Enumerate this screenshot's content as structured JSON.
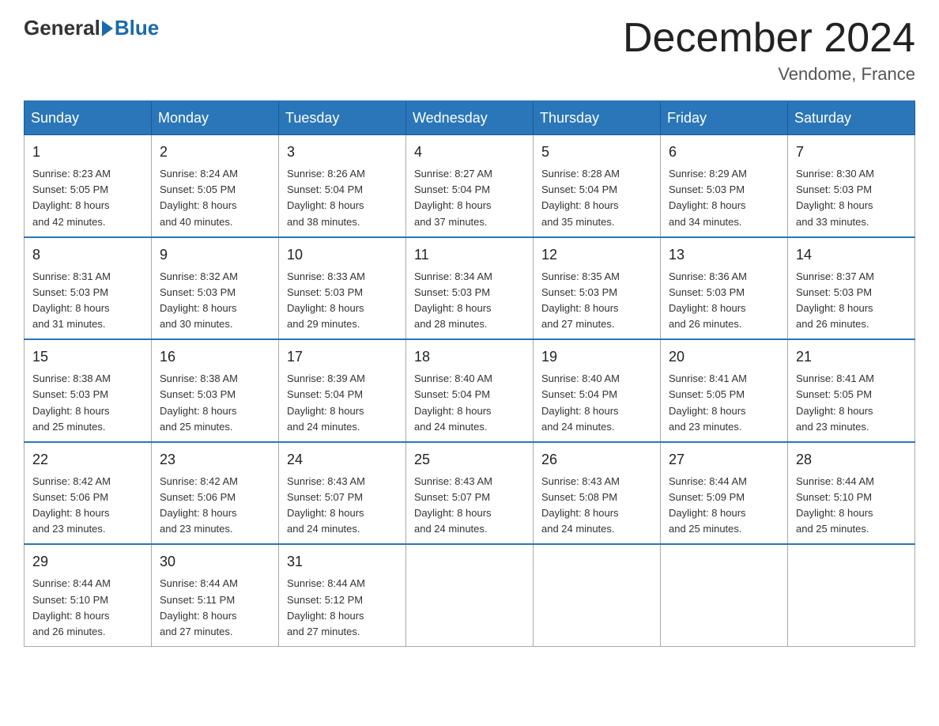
{
  "header": {
    "logo_general": "General",
    "logo_blue": "Blue",
    "month_title": "December 2024",
    "location": "Vendome, France"
  },
  "days_of_week": [
    "Sunday",
    "Monday",
    "Tuesday",
    "Wednesday",
    "Thursday",
    "Friday",
    "Saturday"
  ],
  "weeks": [
    [
      {
        "date": "1",
        "sunrise": "Sunrise: 8:23 AM",
        "sunset": "Sunset: 5:05 PM",
        "daylight": "Daylight: 8 hours",
        "daylight2": "and 42 minutes."
      },
      {
        "date": "2",
        "sunrise": "Sunrise: 8:24 AM",
        "sunset": "Sunset: 5:05 PM",
        "daylight": "Daylight: 8 hours",
        "daylight2": "and 40 minutes."
      },
      {
        "date": "3",
        "sunrise": "Sunrise: 8:26 AM",
        "sunset": "Sunset: 5:04 PM",
        "daylight": "Daylight: 8 hours",
        "daylight2": "and 38 minutes."
      },
      {
        "date": "4",
        "sunrise": "Sunrise: 8:27 AM",
        "sunset": "Sunset: 5:04 PM",
        "daylight": "Daylight: 8 hours",
        "daylight2": "and 37 minutes."
      },
      {
        "date": "5",
        "sunrise": "Sunrise: 8:28 AM",
        "sunset": "Sunset: 5:04 PM",
        "daylight": "Daylight: 8 hours",
        "daylight2": "and 35 minutes."
      },
      {
        "date": "6",
        "sunrise": "Sunrise: 8:29 AM",
        "sunset": "Sunset: 5:03 PM",
        "daylight": "Daylight: 8 hours",
        "daylight2": "and 34 minutes."
      },
      {
        "date": "7",
        "sunrise": "Sunrise: 8:30 AM",
        "sunset": "Sunset: 5:03 PM",
        "daylight": "Daylight: 8 hours",
        "daylight2": "and 33 minutes."
      }
    ],
    [
      {
        "date": "8",
        "sunrise": "Sunrise: 8:31 AM",
        "sunset": "Sunset: 5:03 PM",
        "daylight": "Daylight: 8 hours",
        "daylight2": "and 31 minutes."
      },
      {
        "date": "9",
        "sunrise": "Sunrise: 8:32 AM",
        "sunset": "Sunset: 5:03 PM",
        "daylight": "Daylight: 8 hours",
        "daylight2": "and 30 minutes."
      },
      {
        "date": "10",
        "sunrise": "Sunrise: 8:33 AM",
        "sunset": "Sunset: 5:03 PM",
        "daylight": "Daylight: 8 hours",
        "daylight2": "and 29 minutes."
      },
      {
        "date": "11",
        "sunrise": "Sunrise: 8:34 AM",
        "sunset": "Sunset: 5:03 PM",
        "daylight": "Daylight: 8 hours",
        "daylight2": "and 28 minutes."
      },
      {
        "date": "12",
        "sunrise": "Sunrise: 8:35 AM",
        "sunset": "Sunset: 5:03 PM",
        "daylight": "Daylight: 8 hours",
        "daylight2": "and 27 minutes."
      },
      {
        "date": "13",
        "sunrise": "Sunrise: 8:36 AM",
        "sunset": "Sunset: 5:03 PM",
        "daylight": "Daylight: 8 hours",
        "daylight2": "and 26 minutes."
      },
      {
        "date": "14",
        "sunrise": "Sunrise: 8:37 AM",
        "sunset": "Sunset: 5:03 PM",
        "daylight": "Daylight: 8 hours",
        "daylight2": "and 26 minutes."
      }
    ],
    [
      {
        "date": "15",
        "sunrise": "Sunrise: 8:38 AM",
        "sunset": "Sunset: 5:03 PM",
        "daylight": "Daylight: 8 hours",
        "daylight2": "and 25 minutes."
      },
      {
        "date": "16",
        "sunrise": "Sunrise: 8:38 AM",
        "sunset": "Sunset: 5:03 PM",
        "daylight": "Daylight: 8 hours",
        "daylight2": "and 25 minutes."
      },
      {
        "date": "17",
        "sunrise": "Sunrise: 8:39 AM",
        "sunset": "Sunset: 5:04 PM",
        "daylight": "Daylight: 8 hours",
        "daylight2": "and 24 minutes."
      },
      {
        "date": "18",
        "sunrise": "Sunrise: 8:40 AM",
        "sunset": "Sunset: 5:04 PM",
        "daylight": "Daylight: 8 hours",
        "daylight2": "and 24 minutes."
      },
      {
        "date": "19",
        "sunrise": "Sunrise: 8:40 AM",
        "sunset": "Sunset: 5:04 PM",
        "daylight": "Daylight: 8 hours",
        "daylight2": "and 24 minutes."
      },
      {
        "date": "20",
        "sunrise": "Sunrise: 8:41 AM",
        "sunset": "Sunset: 5:05 PM",
        "daylight": "Daylight: 8 hours",
        "daylight2": "and 23 minutes."
      },
      {
        "date": "21",
        "sunrise": "Sunrise: 8:41 AM",
        "sunset": "Sunset: 5:05 PM",
        "daylight": "Daylight: 8 hours",
        "daylight2": "and 23 minutes."
      }
    ],
    [
      {
        "date": "22",
        "sunrise": "Sunrise: 8:42 AM",
        "sunset": "Sunset: 5:06 PM",
        "daylight": "Daylight: 8 hours",
        "daylight2": "and 23 minutes."
      },
      {
        "date": "23",
        "sunrise": "Sunrise: 8:42 AM",
        "sunset": "Sunset: 5:06 PM",
        "daylight": "Daylight: 8 hours",
        "daylight2": "and 23 minutes."
      },
      {
        "date": "24",
        "sunrise": "Sunrise: 8:43 AM",
        "sunset": "Sunset: 5:07 PM",
        "daylight": "Daylight: 8 hours",
        "daylight2": "and 24 minutes."
      },
      {
        "date": "25",
        "sunrise": "Sunrise: 8:43 AM",
        "sunset": "Sunset: 5:07 PM",
        "daylight": "Daylight: 8 hours",
        "daylight2": "and 24 minutes."
      },
      {
        "date": "26",
        "sunrise": "Sunrise: 8:43 AM",
        "sunset": "Sunset: 5:08 PM",
        "daylight": "Daylight: 8 hours",
        "daylight2": "and 24 minutes."
      },
      {
        "date": "27",
        "sunrise": "Sunrise: 8:44 AM",
        "sunset": "Sunset: 5:09 PM",
        "daylight": "Daylight: 8 hours",
        "daylight2": "and 25 minutes."
      },
      {
        "date": "28",
        "sunrise": "Sunrise: 8:44 AM",
        "sunset": "Sunset: 5:10 PM",
        "daylight": "Daylight: 8 hours",
        "daylight2": "and 25 minutes."
      }
    ],
    [
      {
        "date": "29",
        "sunrise": "Sunrise: 8:44 AM",
        "sunset": "Sunset: 5:10 PM",
        "daylight": "Daylight: 8 hours",
        "daylight2": "and 26 minutes."
      },
      {
        "date": "30",
        "sunrise": "Sunrise: 8:44 AM",
        "sunset": "Sunset: 5:11 PM",
        "daylight": "Daylight: 8 hours",
        "daylight2": "and 27 minutes."
      },
      {
        "date": "31",
        "sunrise": "Sunrise: 8:44 AM",
        "sunset": "Sunset: 5:12 PM",
        "daylight": "Daylight: 8 hours",
        "daylight2": "and 27 minutes."
      },
      null,
      null,
      null,
      null
    ]
  ]
}
